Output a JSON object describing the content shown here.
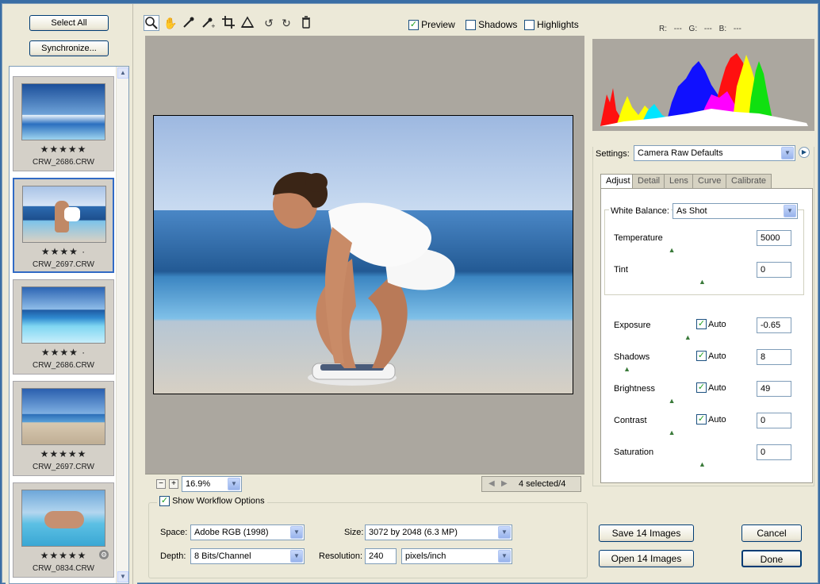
{
  "filmstrip": {
    "select_all": "Select All",
    "synchronize": "Synchronize...",
    "thumbnails": [
      {
        "stars": "★★★★★",
        "name": "CRW_2686.CRW",
        "selected": false
      },
      {
        "stars": "★★★★ ·",
        "name": "CRW_2697.CRW",
        "selected": true
      },
      {
        "stars": "★★★★ ·",
        "name": "CRW_2686.CRW",
        "selected": false
      },
      {
        "stars": "★★★★★",
        "name": "CRW_2697.CRW",
        "selected": false
      },
      {
        "stars": "★★★★★",
        "name": "CRW_0834.CRW",
        "selected": false
      }
    ]
  },
  "toolbar": {
    "tools": [
      "zoom-icon",
      "hand-icon",
      "eyedropper-icon",
      "color-sampler-icon",
      "crop-icon",
      "straighten-icon",
      "rotate-left-icon",
      "rotate-right-icon",
      "trash-icon"
    ],
    "preview_label": "Preview",
    "preview_checked": true,
    "shadows_label": "Shadows",
    "shadows_checked": false,
    "highlights_label": "Highlights",
    "highlights_checked": false
  },
  "statusbar": {
    "zoom": "16.9%",
    "selection": "4 selected/4"
  },
  "workflow": {
    "show_label": "Show Workflow Options",
    "show_checked": true,
    "space_label": "Space:",
    "space_value": "Adobe RGB (1998)",
    "size_label": "Size:",
    "size_value": "3072 by 2048  (6.3 MP)",
    "depth_label": "Depth:",
    "depth_value": "8 Bits/Channel",
    "resolution_label": "Resolution:",
    "resolution_value": "240",
    "resolution_unit": "pixels/inch"
  },
  "info": {
    "rgb": "R: ---   G: ---   B: ---"
  },
  "settings": {
    "label": "Settings:",
    "value": "Camera Raw Defaults",
    "tabs": [
      "Adjust",
      "Detail",
      "Lens",
      "Curve",
      "Calibrate"
    ],
    "active_tab": "Adjust",
    "white_balance_label": "White Balance:",
    "white_balance_value": "As Shot",
    "auto_label": "Auto",
    "sliders": [
      {
        "name": "temperature",
        "label": "Temperature",
        "value": "5000",
        "level": 0.33,
        "auto": null
      },
      {
        "name": "tint",
        "label": "Tint",
        "value": "0",
        "level": 0.5,
        "auto": null
      },
      {
        "name": "exposure",
        "label": "Exposure",
        "value": "-0.65",
        "level": 0.42,
        "auto": true
      },
      {
        "name": "shadows",
        "label": "Shadows",
        "value": "8",
        "level": 0.08,
        "auto": true
      },
      {
        "name": "brightness",
        "label": "Brightness",
        "value": "49",
        "level": 0.33,
        "auto": true
      },
      {
        "name": "contrast",
        "label": "Contrast",
        "value": "0",
        "level": 0.33,
        "auto": true
      },
      {
        "name": "saturation",
        "label": "Saturation",
        "value": "0",
        "level": 0.5,
        "auto": null
      }
    ]
  },
  "actions": {
    "save": "Save 14 Images",
    "open": "Open 14 Images",
    "cancel": "Cancel",
    "done": "Done"
  }
}
